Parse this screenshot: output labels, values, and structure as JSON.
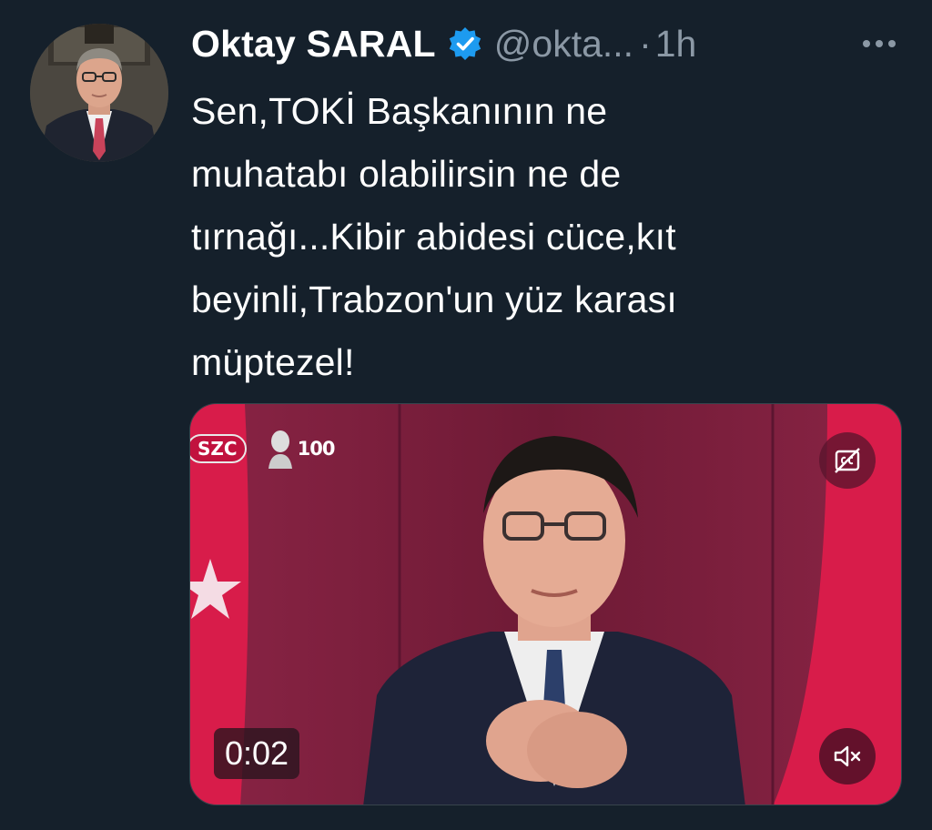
{
  "tweet": {
    "author_name": "Oktay SARAL",
    "handle": "@okta...",
    "separator": "·",
    "time": "1h",
    "text_lines": [
      "Sen,TOKİ Başkanının ne",
      "muhatabı olabilirsin ne de",
      "tırnağı...Kibir abidesi cüce,kıt",
      "beyinli,Trabzon'un yüz karası",
      "müptezel!"
    ]
  },
  "media": {
    "duration": "0:02",
    "channel_logo_text": "SZC",
    "centenary_text": "100"
  },
  "icons": {
    "verified": "verified-badge-icon",
    "more": "more-options-icon",
    "cc": "closed-captions-icon",
    "mute": "muted-speaker-icon"
  },
  "colors": {
    "background": "#15202b",
    "secondary_text": "#8b98a5",
    "verified_blue": "#1d9bf0"
  }
}
